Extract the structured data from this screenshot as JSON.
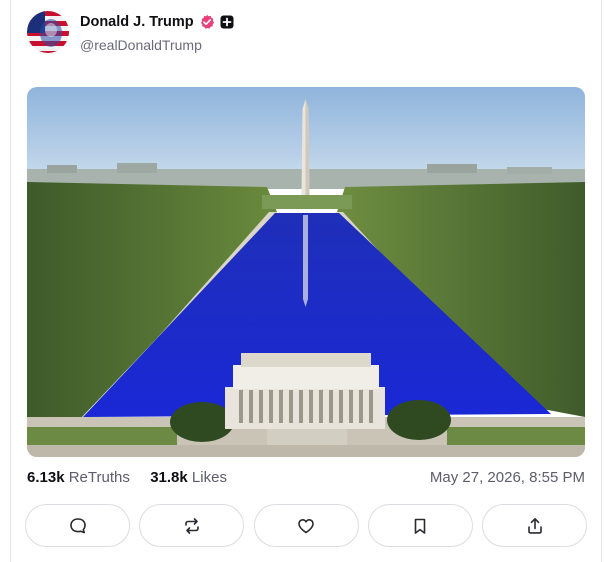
{
  "post": {
    "author_name": "Donald J. Trump",
    "handle": "@realDonaldTrump",
    "retruths_count": "6.13k",
    "retruths_label": "ReTruths",
    "likes_count": "31.8k",
    "likes_label": "Likes",
    "timestamp": "May 27, 2026, 8:55 PM"
  },
  "badges": [
    "verified-icon",
    "plus-icon"
  ],
  "actions": [
    {
      "name": "reply-button",
      "icon": "comment-icon"
    },
    {
      "name": "retruth-button",
      "icon": "repost-icon"
    },
    {
      "name": "like-button",
      "icon": "heart-icon"
    },
    {
      "name": "bookmark-button",
      "icon": "bookmark-icon"
    },
    {
      "name": "share-button",
      "icon": "share-icon"
    }
  ],
  "colors": {
    "verified": "#e8417a",
    "text_primary": "#0f0f14",
    "text_secondary": "#6b6b78",
    "border": "#dcdce2",
    "pool_blue": "#1a2fc9"
  }
}
